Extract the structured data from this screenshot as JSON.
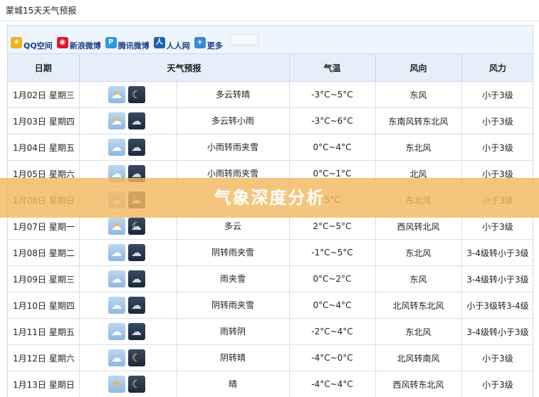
{
  "page_title": "蒙城15天天气预报",
  "share": {
    "items": [
      {
        "label": "QQ空间",
        "icon": "qzone-icon"
      },
      {
        "label": "新浪微博",
        "icon": "sina-weibo-icon"
      },
      {
        "label": "腾讯微博",
        "icon": "tencent-weibo-icon"
      },
      {
        "label": "人人网",
        "icon": "renren-icon"
      },
      {
        "label": "更多",
        "icon": "plus-icon"
      }
    ]
  },
  "table": {
    "headers": [
      "日期",
      "天气预报",
      "气温",
      "风向",
      "风力"
    ],
    "rows": [
      {
        "date": "1月02日 星期三",
        "day_icon": "partly-cloudy",
        "night_icon": "moon",
        "desc": "多云转晴",
        "temp": "-3°C~5°C",
        "wind_dir": "东风",
        "wind_force": "小于3级"
      },
      {
        "date": "1月03日 星期四",
        "day_icon": "partly-cloudy",
        "night_icon": "light-rain",
        "desc": "多云转小雨",
        "temp": "-3°C~6°C",
        "wind_dir": "东南风转东北风",
        "wind_force": "小于3级"
      },
      {
        "date": "1月04日 星期五",
        "day_icon": "sleet",
        "night_icon": "sleet",
        "desc": "小雨转雨夹雪",
        "temp": "0°C~4°C",
        "wind_dir": "东北风",
        "wind_force": "小于3级"
      },
      {
        "date": "1月05日 星期六",
        "day_icon": "sleet",
        "night_icon": "sleet",
        "desc": "小雨转雨夹雪",
        "temp": "0°C~1°C",
        "wind_dir": "北风",
        "wind_force": "小于3级"
      },
      {
        "date": "1月06日 星期日",
        "day_icon": "partly-cloudy",
        "night_icon": "cloudy-night",
        "desc": "",
        "temp": "5°C",
        "wind_dir": "东北风",
        "wind_force": "小于3级"
      },
      {
        "date": "1月07日 星期一",
        "day_icon": "partly-cloudy",
        "night_icon": "cloudy-night",
        "desc": "多云",
        "temp": "2°C~5°C",
        "wind_dir": "西风转北风",
        "wind_force": "小于3级"
      },
      {
        "date": "1月08日 星期二",
        "day_icon": "cloudy",
        "night_icon": "sleet",
        "desc": "阴转雨夹雪",
        "temp": "-1°C~5°C",
        "wind_dir": "东北风",
        "wind_force": "3-4级转小于3级"
      },
      {
        "date": "1月09日 星期三",
        "day_icon": "sleet",
        "night_icon": "sleet",
        "desc": "雨夹雪",
        "temp": "0°C~2°C",
        "wind_dir": "东风",
        "wind_force": "3-4级转小于3级"
      },
      {
        "date": "1月10日 星期四",
        "day_icon": "cloudy",
        "night_icon": "sleet",
        "desc": "阴转雨夹雪",
        "temp": "0°C~4°C",
        "wind_dir": "北风转东北风",
        "wind_force": "小于3级转3-4级"
      },
      {
        "date": "1月11日 星期五",
        "day_icon": "sleet",
        "night_icon": "cloudy",
        "desc": "雨转阴",
        "temp": "-2°C~4°C",
        "wind_dir": "东北风",
        "wind_force": "3-4级转小于3级"
      },
      {
        "date": "1月12日 星期六",
        "day_icon": "cloudy",
        "night_icon": "moon",
        "desc": "阴转晴",
        "temp": "-4°C~0°C",
        "wind_dir": "北风转南风",
        "wind_force": "小于3级"
      },
      {
        "date": "1月13日 星期日",
        "day_icon": "sun",
        "night_icon": "moon",
        "desc": "晴",
        "temp": "-4°C~4°C",
        "wind_dir": "西风转东北风",
        "wind_force": "小于3级"
      }
    ]
  },
  "overlay": {
    "text": "气象深度分析"
  }
}
